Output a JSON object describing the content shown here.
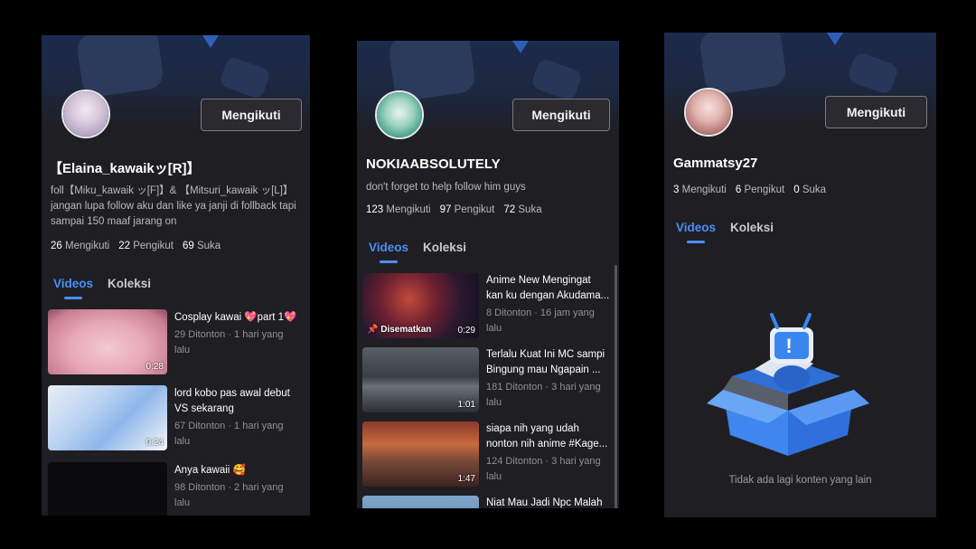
{
  "panel1": {
    "username": "【Elaina_kawaikッ[R]】",
    "bio": "foll【Miku_kawaik ッ[F]】& 【Mitsuri_kawaik ッ[L]】 jangan lupa follow aku dan like ya janji  di follback tapi sampai 150 maaf jarang on",
    "follow_label": "Mengikuti",
    "stats": {
      "following_count": "26",
      "following_label": "Mengikuti",
      "followers_count": "22",
      "followers_label": "Pengikut",
      "likes_count": "69",
      "likes_label": "Suka"
    },
    "tabs": [
      "Videos",
      "Koleksi"
    ],
    "videos": [
      {
        "title": "Cosplay kawai 💖part 1💖",
        "meta": "29 Ditonton · 1 hari yang lalu",
        "duration": "0:28"
      },
      {
        "title": "lord kobo pas awal debut VS sekarang",
        "meta": "67 Ditonton · 1 hari yang lalu",
        "duration": "0:24"
      },
      {
        "title": "Anya kawaii 🥰",
        "meta": "98 Ditonton · 2 hari yang lalu",
        "duration": ""
      }
    ]
  },
  "panel2": {
    "username": "NOKIAABSOLUTELY",
    "bio": "don't forget to help follow him guys",
    "follow_label": "Mengikuti",
    "stats": {
      "following_count": "123",
      "following_label": "Mengikuti",
      "followers_count": "97",
      "followers_label": "Pengikut",
      "likes_count": "72",
      "likes_label": "Suka"
    },
    "tabs": [
      "Videos",
      "Koleksi"
    ],
    "pinned_label": "📌 Disematkan",
    "videos": [
      {
        "title_line1": "Anime New Mengingat",
        "title_line2": "kan ku dengan Akudama...",
        "meta": "8 Ditonton · 16 jam yang lalu",
        "duration": "0:29"
      },
      {
        "title_line1": "Terlalu Kuat Ini MC sampi",
        "title_line2": "Bingung mau Ngapain ...",
        "meta": "181 Ditonton · 3 hari yang lalu",
        "duration": "1:01"
      },
      {
        "title_line1": "siapa nih yang udah",
        "title_line2": "nonton nih anime #Kage...",
        "meta": "124 Ditonton · 3 hari yang lalu",
        "duration": "1:47"
      },
      {
        "title_line1": "Niat Mau Jadi Npc Malah",
        "title_line2": "",
        "meta": "",
        "duration": ""
      }
    ]
  },
  "panel3": {
    "username": "Gammatsy27",
    "follow_label": "Mengikuti",
    "stats": {
      "following_count": "3",
      "following_label": "Mengikuti",
      "followers_count": "6",
      "followers_label": "Pengikut",
      "likes_count": "0",
      "likes_label": "Suka"
    },
    "tabs": [
      "Videos",
      "Koleksi"
    ],
    "empty_text": "Tidak ada lagi konten yang lain"
  },
  "colors": {
    "accent": "#4b8ef7",
    "panel_bg": "#1f1f23",
    "page_bg": "#000000"
  }
}
